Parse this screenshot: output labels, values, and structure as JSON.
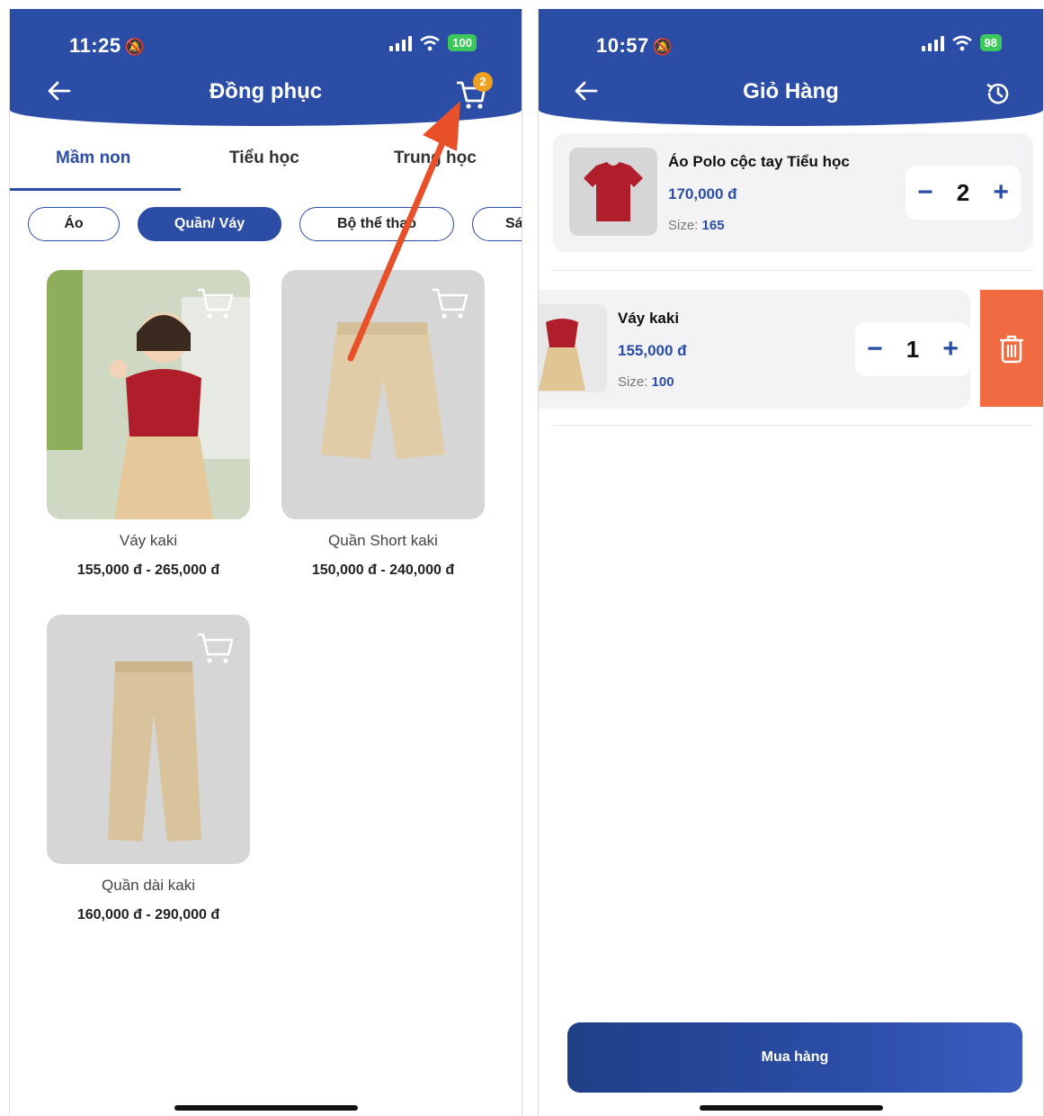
{
  "left": {
    "status": {
      "time": "11:25",
      "battery": "100"
    },
    "title": "Đồng phục",
    "cart_badge": "2",
    "tabs": [
      "Mầm non",
      "Tiểu học",
      "Trung học"
    ],
    "chips": [
      "Áo",
      "Quần/ Váy",
      "Bộ thể thao",
      "Sá"
    ],
    "products": [
      {
        "name": "Váy kaki",
        "price": "155,000 đ - 265,000 đ"
      },
      {
        "name": "Quần Short kaki",
        "price": "150,000 đ - 240,000 đ"
      },
      {
        "name": "Quần dài kaki",
        "price": "160,000 đ - 290,000 đ"
      }
    ]
  },
  "right": {
    "status": {
      "time": "10:57",
      "battery": "98"
    },
    "title": "Giỏ Hàng",
    "items": [
      {
        "name": "Áo Polo cộc tay Tiểu học",
        "price": "170,000 đ",
        "size_label": "Size:",
        "size": "165",
        "qty": "2"
      },
      {
        "name": "Váy kaki",
        "price": "155,000 đ",
        "size_label": "Size:",
        "size": "100",
        "qty": "1"
      }
    ],
    "buy_label": "Mua hàng"
  },
  "colors": {
    "primary": "#2b4da6",
    "badge": "#f0a020",
    "delete": "#f06a42",
    "arrow": "#e8502a"
  }
}
